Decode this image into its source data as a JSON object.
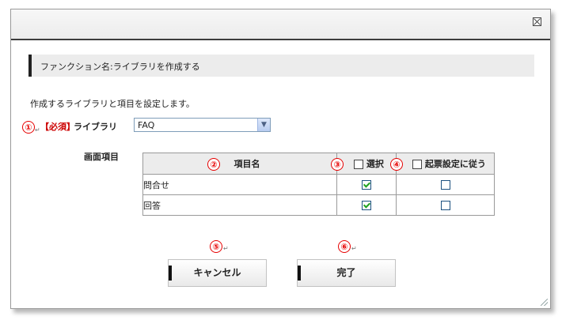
{
  "dialog": {
    "section_title": "ファンクション名:ライブラリを作成する",
    "description": "作成するライブラリと項目を設定します。",
    "required_mark": "【必須】",
    "library_label": "ライブラリ",
    "library_select_value": "FAQ",
    "screen_items_label": "画面項目",
    "table": {
      "headers": {
        "name": "項目名",
        "select": "選択",
        "follow": "起票設定に従う"
      },
      "rows": [
        {
          "name": "問合せ",
          "selected": true,
          "follow": false
        },
        {
          "name": "回答",
          "selected": true,
          "follow": false
        }
      ]
    },
    "buttons": {
      "cancel": "キャンセル",
      "done": "完了"
    }
  },
  "annotations": {
    "n1": "①",
    "n2": "②",
    "n3": "③",
    "n4": "④",
    "n5": "⑤",
    "n6": "⑥",
    "enter_mark": "↵"
  },
  "colors": {
    "annotation": "#e60000",
    "required": "#cc0000",
    "check": "#21a121"
  }
}
